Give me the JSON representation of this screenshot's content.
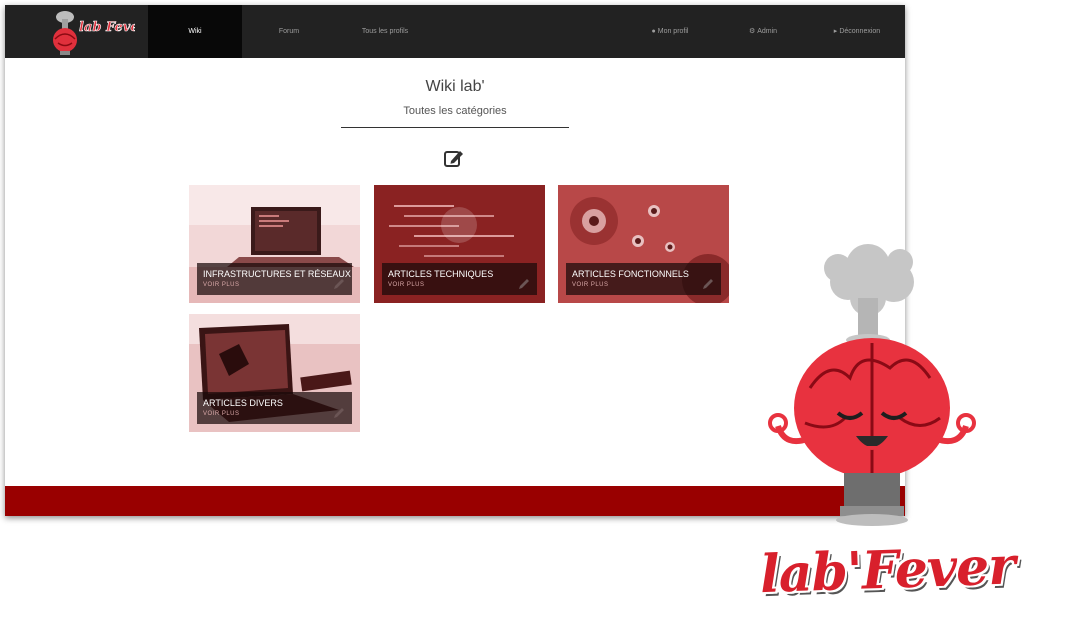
{
  "nav": {
    "items": [
      {
        "label": "Wiki",
        "active": true
      },
      {
        "label": "Forum",
        "active": false
      },
      {
        "label": "Tous les profils",
        "active": false
      }
    ],
    "right": [
      {
        "label": "Mon profil",
        "icon": "user-icon"
      },
      {
        "label": "Admin",
        "icon": "gears-icon"
      },
      {
        "label": "Déconnexion",
        "icon": "logout-icon"
      }
    ]
  },
  "header": {
    "title": "Wiki lab'",
    "subtitle": "Toutes les catégories"
  },
  "categories": [
    {
      "title": "INFRASTRUCTURES ET RÉSEAUX",
      "link": "VOIR PLUS",
      "image": "laptop-desk-photo"
    },
    {
      "title": "ARTICLES TECHNIQUES",
      "link": "VOIR PLUS",
      "image": "code-screen-photo"
    },
    {
      "title": "ARTICLES FONCTIONNELS",
      "link": "VOIR PLUS",
      "image": "watch-movement-photo"
    },
    {
      "title": "ARTICLES DIVERS",
      "link": "VOIR PLUS",
      "image": "macbook-workspace-photo"
    }
  ],
  "brand": {
    "name": "lab'Fever",
    "logo_text": "lab Fever"
  },
  "colors": {
    "navbar": "#222222",
    "accent": "#990000",
    "brand_red": "#d8202c"
  }
}
